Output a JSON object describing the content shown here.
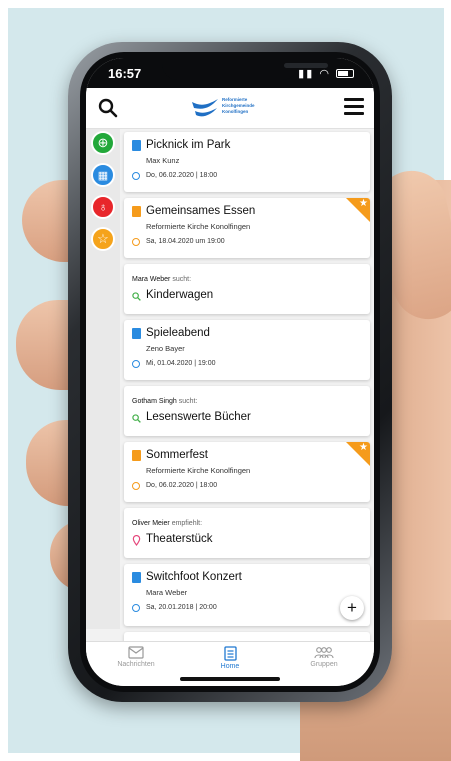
{
  "status": {
    "time": "16:57"
  },
  "header": {
    "logo_lines": [
      "Reformierte",
      "Kirchgemeinde",
      "Konolfingen"
    ]
  },
  "colors": {
    "accent_blue": "#1f78d1",
    "event_blue": "#2a8be0",
    "event_orange": "#f59b1b",
    "search_green": "#43b04a",
    "recommend_pink": "#e5457a"
  },
  "sidebar": {
    "items": [
      {
        "icon": "globe-icon",
        "color": "#22a83a"
      },
      {
        "icon": "calendar-icon",
        "color": "#2a8be0"
      },
      {
        "icon": "lightbulb-icon",
        "color": "#e8262b"
      },
      {
        "icon": "star-icon",
        "color": "#f5a31b"
      }
    ]
  },
  "feed": [
    {
      "kind": "event",
      "color": "blue",
      "title": "Picknick im Park",
      "sub": "Max Kunz",
      "meta": "Do, 06.02.2020 | 18:00",
      "featured": false
    },
    {
      "kind": "event",
      "color": "orange",
      "title": "Gemeinsames Essen",
      "sub": "Reformierte Kirche Konolfingen",
      "meta": "Sa, 18.04.2020 um 19:00",
      "featured": true
    },
    {
      "kind": "search",
      "who": "Mara Weber",
      "verb": "sucht:",
      "title": "Kinderwagen"
    },
    {
      "kind": "event",
      "color": "blue",
      "title": "Spieleabend",
      "sub": "Zeno Bayer",
      "meta": "Mi, 01.04.2020 | 19:00",
      "featured": false
    },
    {
      "kind": "search",
      "who": "Gotham Singh",
      "verb": "sucht:",
      "title": "Lesenswerte Bücher"
    },
    {
      "kind": "event",
      "color": "orange",
      "title": "Sommerfest",
      "sub": "Reformierte Kirche Konolfingen",
      "meta": "Do, 06.02.2020 | 18:00",
      "featured": true
    },
    {
      "kind": "recommend",
      "who": "Oliver Meier",
      "verb": "empfiehlt:",
      "title": "Theaterstück"
    },
    {
      "kind": "event",
      "color": "blue",
      "title": "Switchfoot Konzert",
      "sub": "Mara Weber",
      "meta": "Sa, 20.01.2018 | 20:00",
      "featured": false
    }
  ],
  "fab": {
    "label": "+"
  },
  "nav": {
    "items": [
      {
        "label": "Nachrichten"
      },
      {
        "label": "Home"
      },
      {
        "label": "Gruppen"
      }
    ]
  }
}
